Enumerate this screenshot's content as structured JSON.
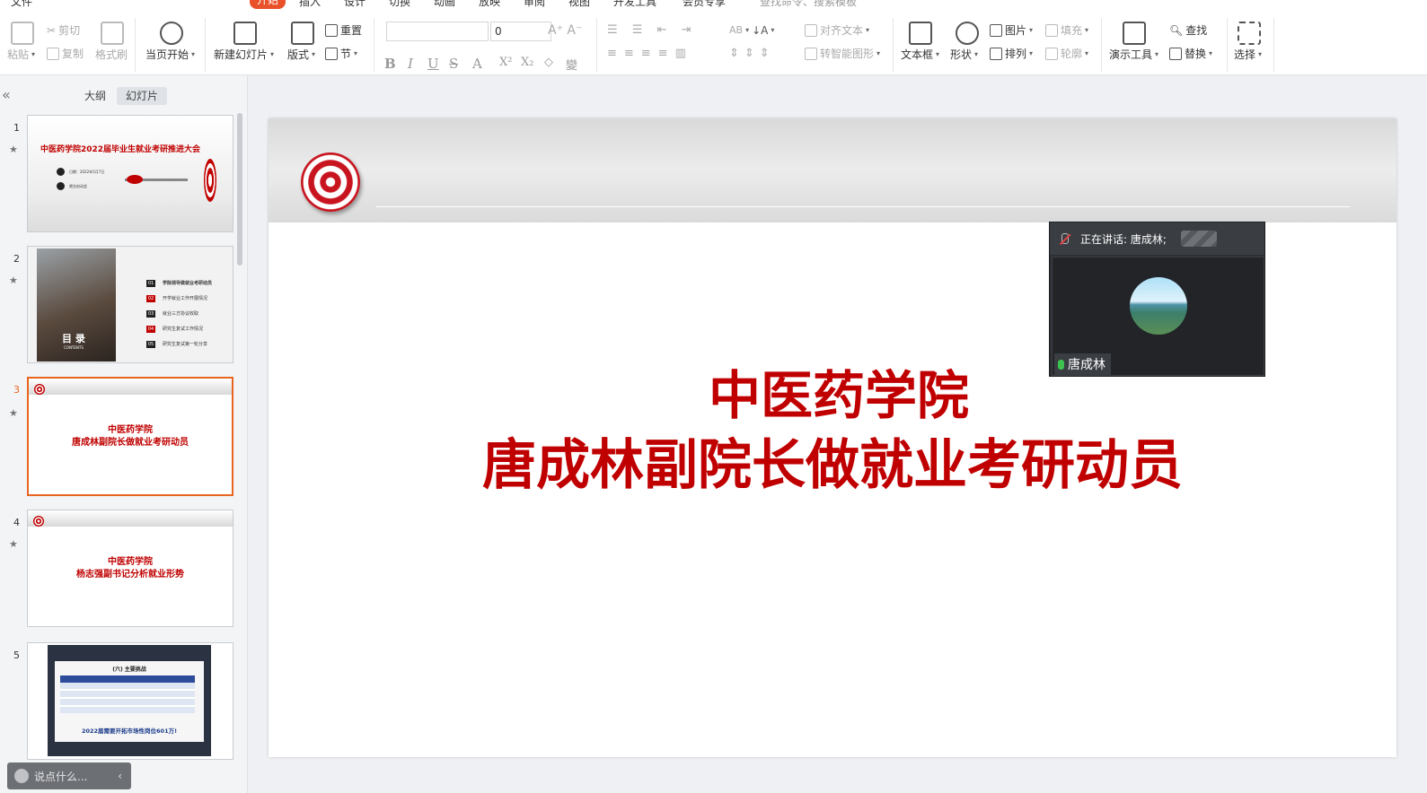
{
  "menu": {
    "items": [
      "文件",
      "开始",
      "插入",
      "设计",
      "切换",
      "动画",
      "放映",
      "审阅",
      "视图",
      "开发工具",
      "会员专享"
    ],
    "active": "开始",
    "search_placeholder": "查找命令、搜索模板"
  },
  "ribbon": {
    "paste": "粘贴",
    "cut": "剪切",
    "copy": "复制",
    "format_painter": "格式刷",
    "from_current": "当页开始",
    "new_slide": "新建幻灯片",
    "layout": "版式",
    "reset": "重置",
    "section": "节",
    "font_size": "0",
    "align_text": "对齐文本",
    "smart_shape": "转智能图形",
    "textbox": "文本框",
    "shape": "形状",
    "picture": "图片",
    "arrange": "排列",
    "fill": "填充",
    "outline": "轮廓",
    "presenter_tools": "演示工具",
    "find": "查找",
    "replace": "替换",
    "select": "选择"
  },
  "left_panel": {
    "tab_outline": "大纲",
    "tab_slides": "幻灯片",
    "chat_placeholder": "说点什么..."
  },
  "thumbnails": [
    {
      "num": "1",
      "title": "中医药学院2022届毕业生就业考研推进大会",
      "line1": "日期：2022年5月7日",
      "line2": "就业启动会"
    },
    {
      "num": "2",
      "cover": "目 录",
      "cover_sub": "CONTENTS",
      "items": [
        {
          "no": "01",
          "text": "学院领导做就业考研动员"
        },
        {
          "no": "02",
          "text": "开学就业工作开展情况"
        },
        {
          "no": "03",
          "text": "就业三方协议收取"
        },
        {
          "no": "04",
          "text": "研究生复试工作情况"
        },
        {
          "no": "05",
          "text": "研究生复试第一轮分享"
        }
      ]
    },
    {
      "num": "3",
      "line1": "中医药学院",
      "line2": "唐成林副院长做就业考研动员"
    },
    {
      "num": "4",
      "line1": "中医药学院",
      "line2": "杨志强副书记分析就业形势"
    },
    {
      "num": "5",
      "heading": "(六) 主要挑战",
      "footer": "2022届需要开拓市场性岗位601万!"
    }
  ],
  "slide": {
    "title_line1": "中医药学院",
    "title_line2": "唐成林副院长做就业考研动员"
  },
  "video": {
    "speaking_label": "正在讲话: 唐成林;",
    "participant_name": "唐成林"
  },
  "colors": {
    "accent": "#e8512a",
    "title_red": "#c00000",
    "selected_border": "#e8651f"
  }
}
